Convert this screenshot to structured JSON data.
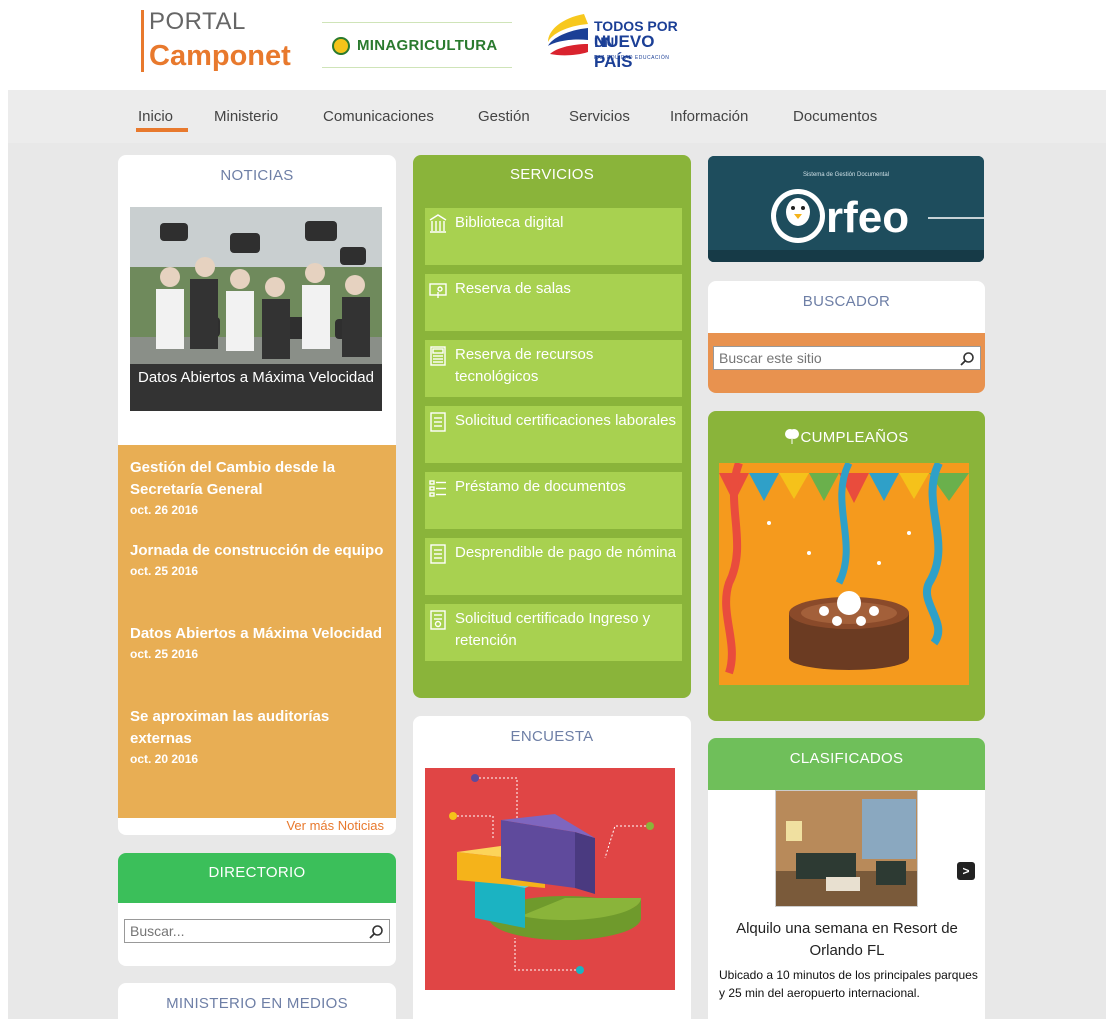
{
  "header": {
    "portal_line1": "PORTAL",
    "portal_line2": "Camponet",
    "minagri": "MINAGRICULTURA",
    "todos_line1": "TODOS POR UN",
    "todos_line2": "NUEVO PAÍS",
    "todos_line3": "PAZ  EQUIDAD  EDUCACIÓN"
  },
  "nav": {
    "items": [
      "Inicio",
      "Ministerio",
      "Comunicaciones",
      "Gestión",
      "Servicios",
      "Información",
      "Documentos"
    ],
    "active": "Inicio",
    "accent": "#e8792d"
  },
  "noticias": {
    "title": "NOTICIAS",
    "caption": "Datos Abiertos a Máxima Velocidad",
    "items": [
      {
        "title": "Gestión del Cambio desde la Secretaría General",
        "date": "oct. 26 2016"
      },
      {
        "title": "Jornada de construcción de equipo",
        "date": "oct. 25 2016"
      },
      {
        "title": "Datos Abiertos a Máxima Velocidad",
        "date": "oct. 25 2016"
      },
      {
        "title": "Se aproximan las auditorías externas",
        "date": "oct. 20 2016"
      }
    ],
    "more_link": "Ver más Noticias"
  },
  "directorio": {
    "title": "DIRECTORIO",
    "search_placeholder": "Buscar..."
  },
  "medios": {
    "title": "MINISTERIO EN MEDIOS"
  },
  "servicios": {
    "title": "SERVICIOS",
    "items": [
      {
        "label": "Biblioteca digital",
        "icon": "library-icon"
      },
      {
        "label": "Reserva de salas",
        "icon": "room-icon"
      },
      {
        "label": "Reserva de recursos tecnológicos",
        "icon": "calculator-icon"
      },
      {
        "label": "Solicitud certificaciones laborales",
        "icon": "document-icon"
      },
      {
        "label": "Préstamo de documentos",
        "icon": "list-icon"
      },
      {
        "label": "Desprendible de pago de nómina",
        "icon": "document-icon"
      },
      {
        "label": "Solicitud certificado Ingreso y retención",
        "icon": "certificate-icon"
      }
    ]
  },
  "encuesta": {
    "title": "ENCUESTA"
  },
  "orfeo": {
    "subtitle": "Sistema de Gestión Documental",
    "brand": "rfeo"
  },
  "buscador": {
    "title": "BUSCADOR",
    "search_placeholder": "Buscar este sitio"
  },
  "cumpleanos": {
    "title": "CUMPLEAÑOS"
  },
  "clasificados": {
    "title": "CLASIFICADOS",
    "next_label": ">",
    "item_title": "Alquilo una semana en Resort de Orlando FL",
    "item_desc": "Ubicado a 10 minutos de los principales parques y 25 min del aeropuerto internacional."
  }
}
